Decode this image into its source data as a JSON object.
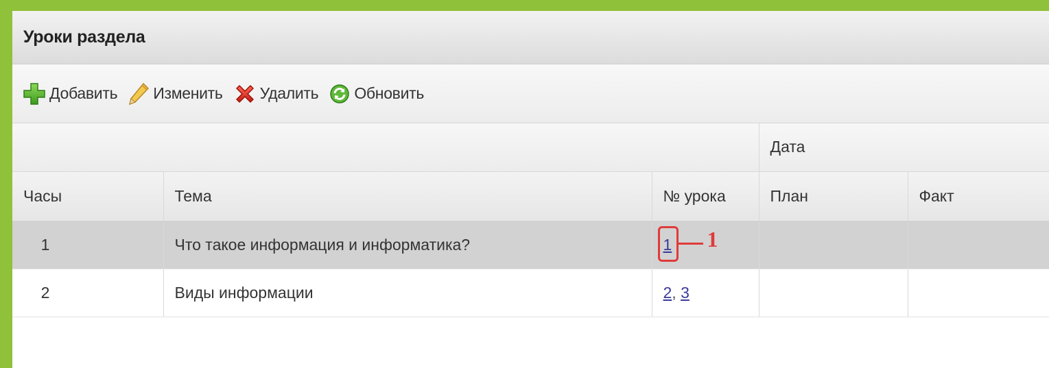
{
  "panel": {
    "title": "Уроки раздела"
  },
  "toolbar": {
    "add_label": "Добавить",
    "edit_label": "Изменить",
    "delete_label": "Удалить",
    "refresh_label": "Обновить",
    "icons": {
      "add": "plus-icon",
      "edit": "pencil-icon",
      "delete": "x-icon",
      "refresh": "refresh-icon"
    }
  },
  "table": {
    "group_header": "Дата",
    "columns": {
      "hours": "Часы",
      "topic": "Тема",
      "lesson_no": "№ урока",
      "plan": "План",
      "fact": "Факт"
    },
    "rows": [
      {
        "hours": "1",
        "topic": "Что такое информация и информатика?",
        "lessons": [
          "1"
        ],
        "plan": "",
        "fact": "",
        "selected": true
      },
      {
        "hours": "2",
        "topic": "Виды информации",
        "lessons": [
          "2",
          "3"
        ],
        "plan": "",
        "fact": "",
        "selected": false
      }
    ]
  },
  "annotation": {
    "label": "1",
    "color": "#e03a3a"
  },
  "colors": {
    "background": "#8fc23a",
    "selected_row": "#d2d2d2",
    "link": "#3a3a9a"
  }
}
